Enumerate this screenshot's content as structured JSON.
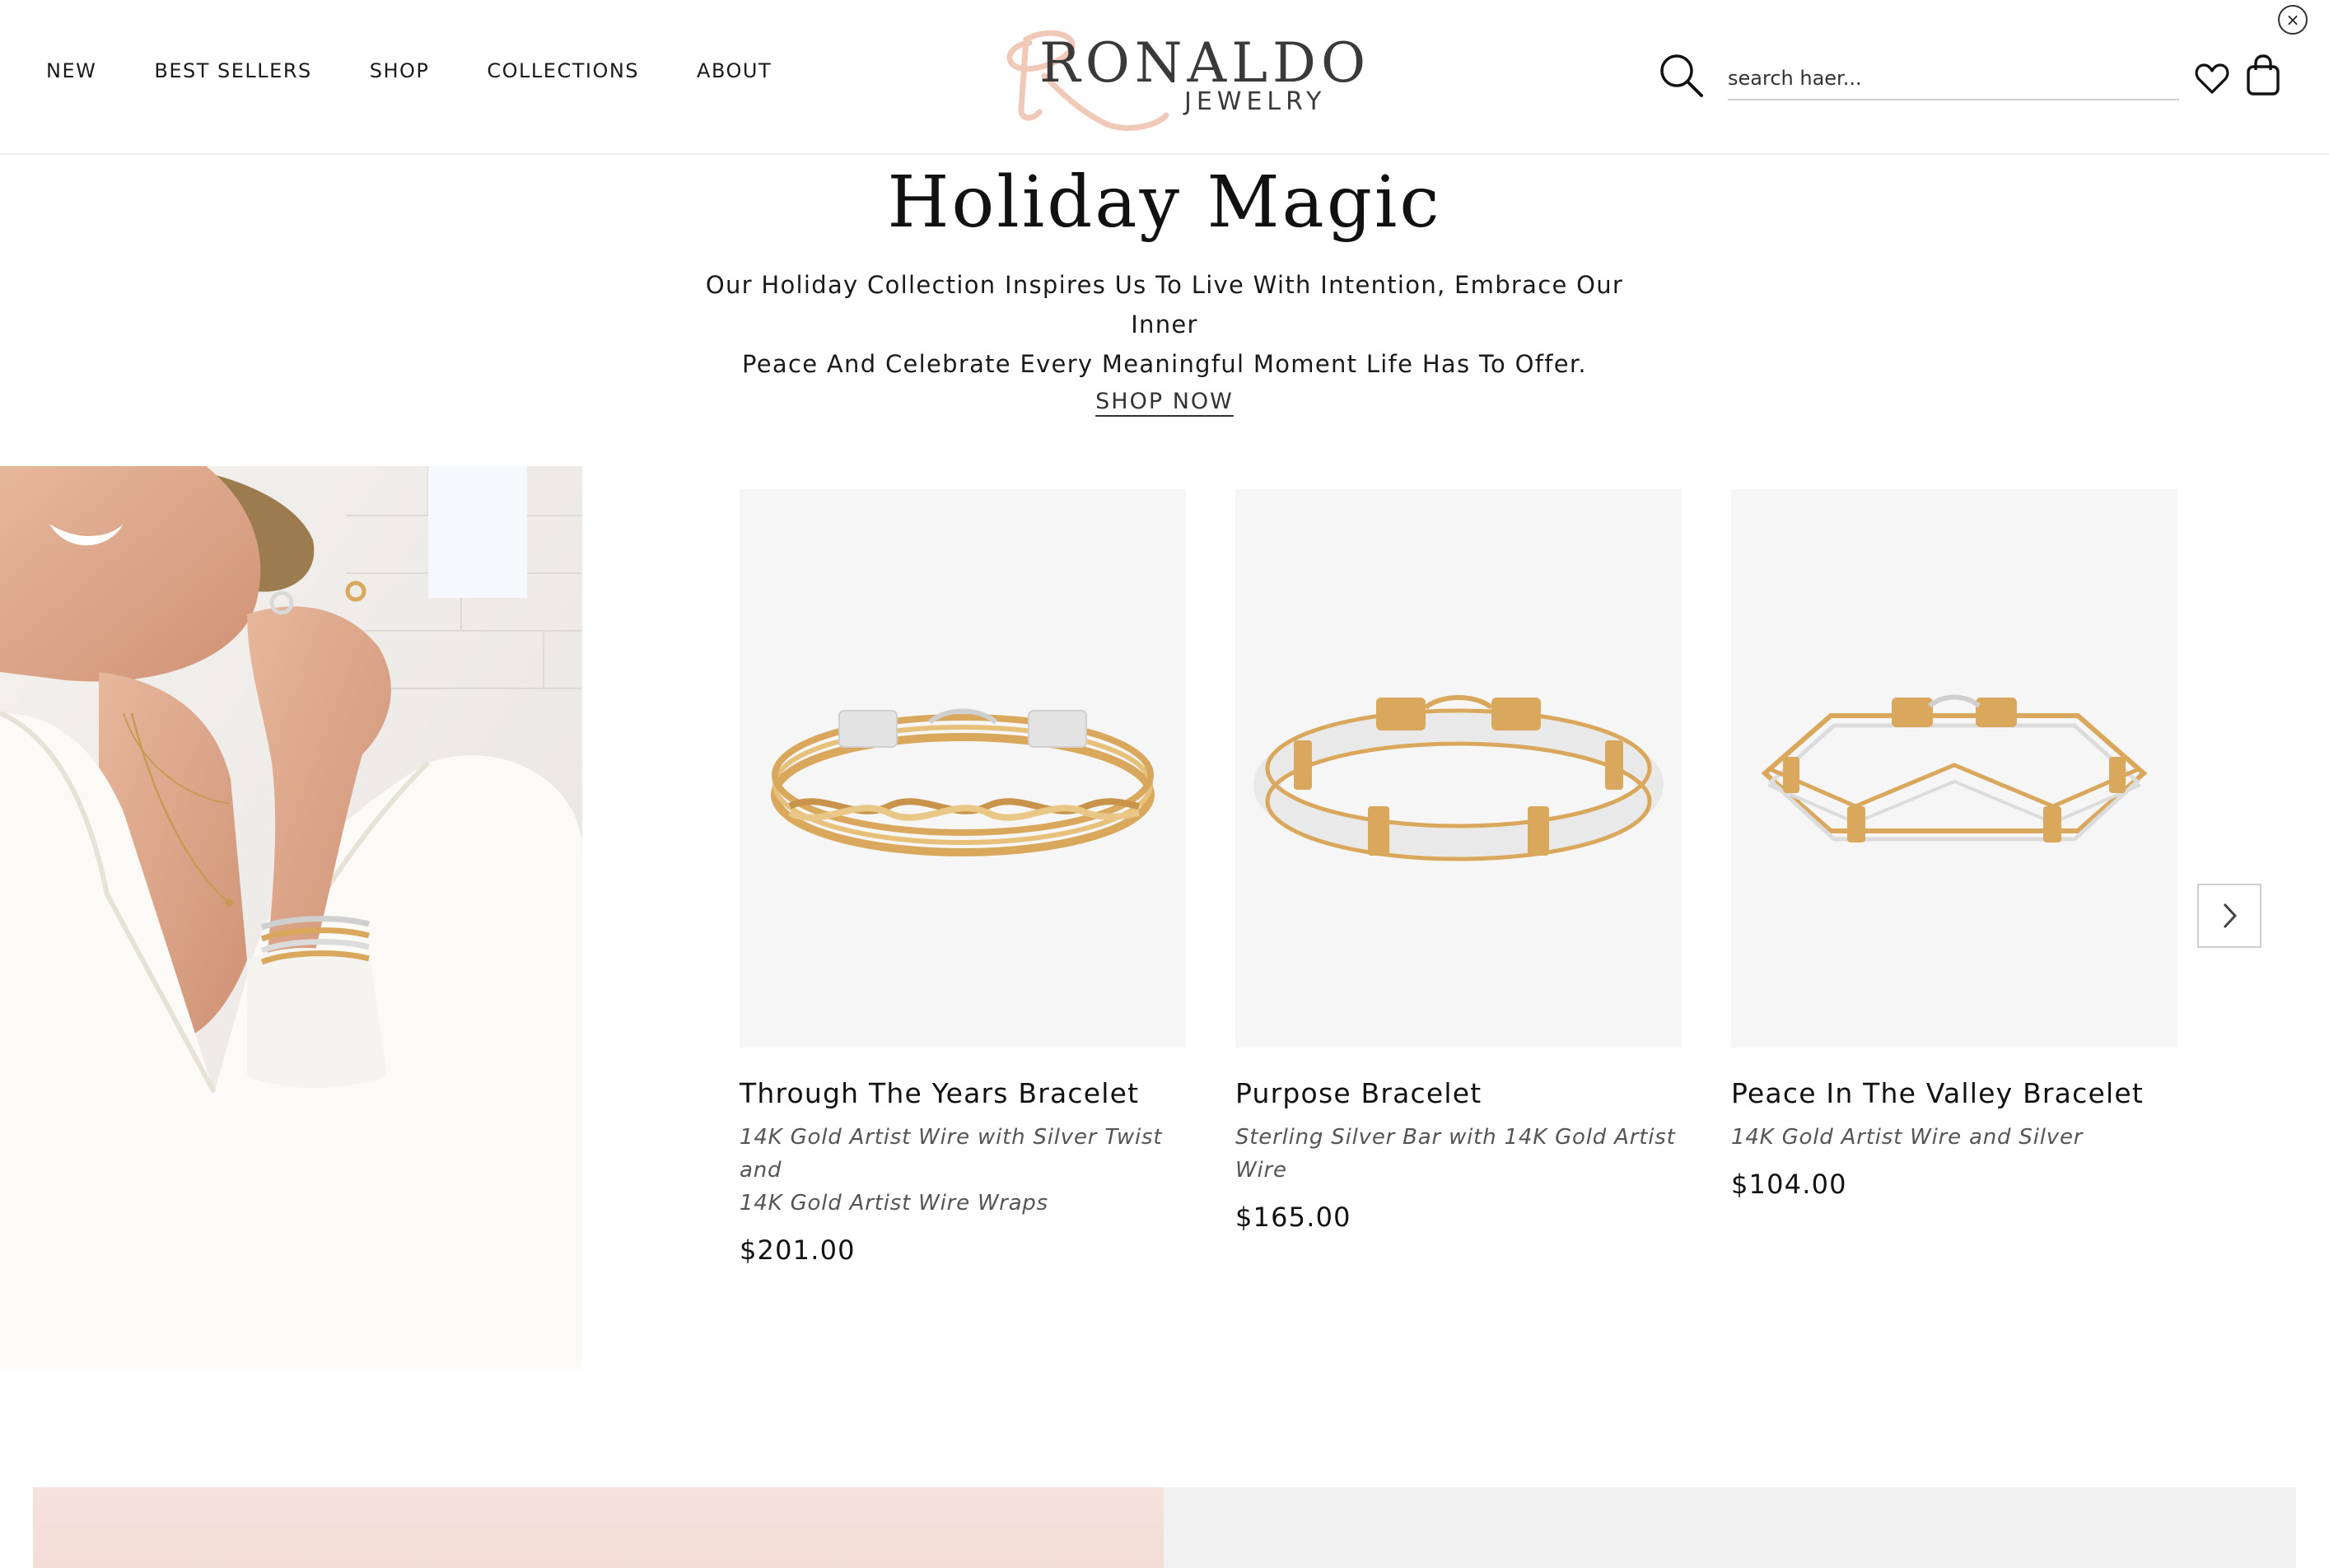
{
  "header": {
    "nav": [
      "NEW",
      "BEST SELLERS",
      "SHOP",
      "COLLECTIONS",
      "ABOUT"
    ],
    "logo": {
      "word": "RONALDO",
      "sub": "JEWELRY"
    },
    "search": {
      "placeholder": "search haer..."
    },
    "icons": [
      "search-icon",
      "heart-icon",
      "bag-icon",
      "close-icon"
    ],
    "close_glyph": "×"
  },
  "hero": {
    "title": "Holiday Magic",
    "description_line1": "Our Holiday Collection Inspires Us To Live With Intention, Embrace Our Inner",
    "description_line2": "Peace And Celebrate Every Meaningful Moment Life Has To Offer.",
    "cta": "SHOP NOW"
  },
  "products": [
    {
      "name": "Through The Years Bracelet",
      "desc_line1": "14K Gold Artist Wire with Silver Twist and",
      "desc_line2": "14K Gold Artist Wire Wraps",
      "price": "$201.00"
    },
    {
      "name": "Purpose Bracelet",
      "desc_line1": "Sterling Silver Bar with 14K Gold Artist",
      "desc_line2": "Wire",
      "price": "$165.00"
    },
    {
      "name": "Peace In The Valley Bracelet",
      "desc_line1": "14K Gold Artist Wire and Silver",
      "desc_line2": "",
      "price": "$104.00"
    }
  ],
  "colors": {
    "gold": "#d9a85c",
    "silver": "#dcdcdc",
    "card_bg": "#f6f6f6",
    "logo_accent": "#f0c9b8",
    "banner_pink": "#f6e3dd"
  }
}
